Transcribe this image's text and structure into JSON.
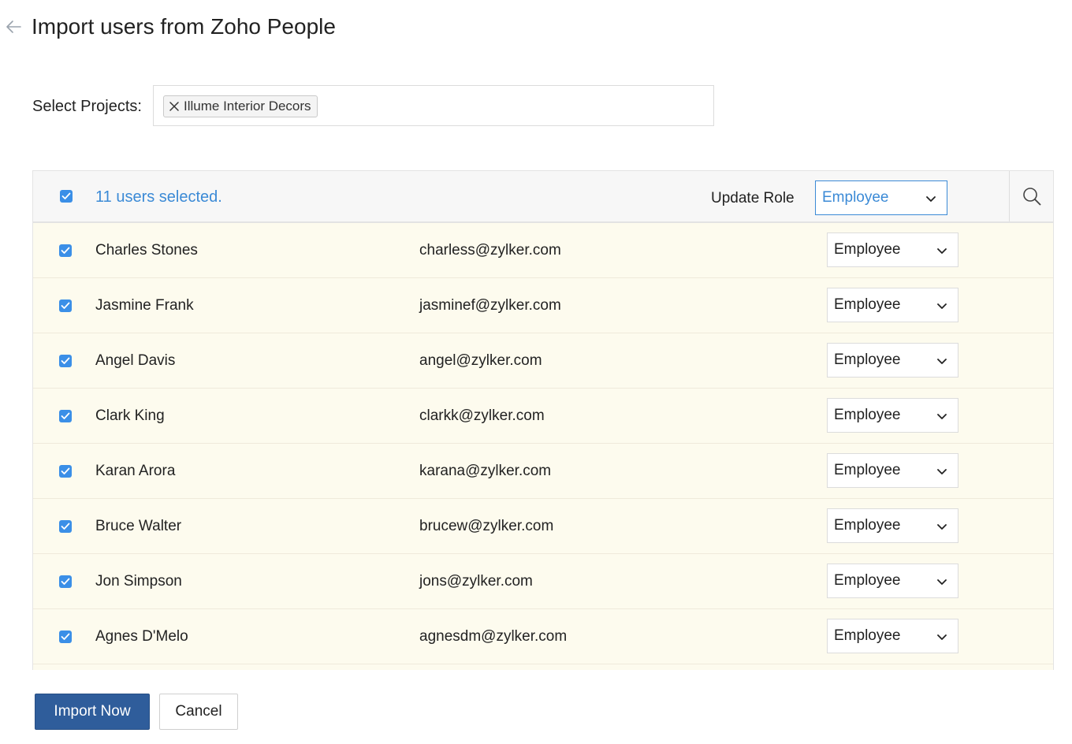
{
  "header": {
    "title": "Import users from Zoho People"
  },
  "projects": {
    "label": "Select Projects:",
    "selected": [
      {
        "name": "Illume Interior Decors"
      }
    ]
  },
  "table": {
    "selected_text": "11 users selected.",
    "update_role_label": "Update Role",
    "bulk_role_value": "Employee",
    "rows": [
      {
        "name": "Charles Stones",
        "email": "charless@zylker.com",
        "role": "Employee",
        "checked": true
      },
      {
        "name": "Jasmine Frank",
        "email": "jasminef@zylker.com",
        "role": "Employee",
        "checked": true
      },
      {
        "name": "Angel Davis",
        "email": "angel@zylker.com",
        "role": "Employee",
        "checked": true
      },
      {
        "name": "Clark King",
        "email": "clarkk@zylker.com",
        "role": "Employee",
        "checked": true
      },
      {
        "name": "Karan Arora",
        "email": "karana@zylker.com",
        "role": "Employee",
        "checked": true
      },
      {
        "name": "Bruce Walter",
        "email": "brucew@zylker.com",
        "role": "Employee",
        "checked": true
      },
      {
        "name": "Jon Simpson",
        "email": "jons@zylker.com",
        "role": "Employee",
        "checked": true
      },
      {
        "name": "Agnes D'Melo",
        "email": "agnesdm@zylker.com",
        "role": "Employee",
        "checked": true
      }
    ]
  },
  "actions": {
    "import_label": "Import Now",
    "cancel_label": "Cancel"
  },
  "colors": {
    "accent": "#3b8ad6",
    "checkbox": "#3b8fe7",
    "primary_button": "#2f5d9b",
    "row_background": "#fdfbee",
    "header_background": "#f7f7f7"
  },
  "icons": {
    "back": "arrow-left-icon",
    "chip_remove": "close-icon",
    "dropdown": "chevron-down-icon",
    "search": "search-icon",
    "checkbox": "checkmark-icon"
  }
}
